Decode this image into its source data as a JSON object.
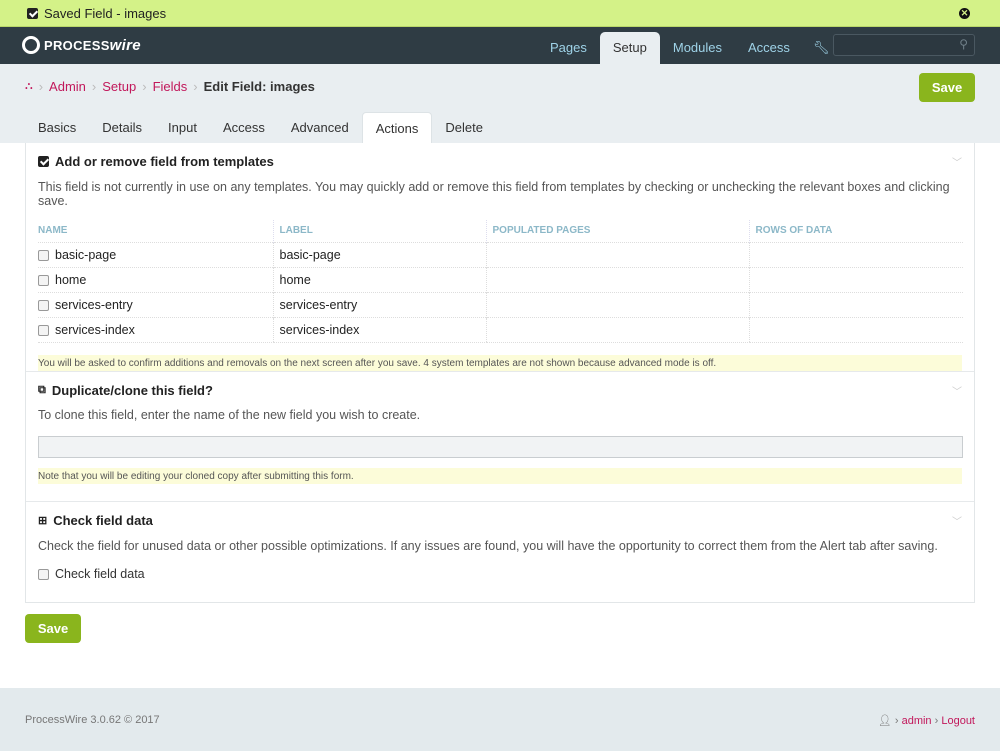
{
  "notice": {
    "text": "Saved Field - images",
    "icon": "check-square-icon",
    "close_icon": "close-circle-icon"
  },
  "header": {
    "logo": "PROCESSwire",
    "logo_a": "PROCESS",
    "logo_b": "wire",
    "nav": [
      "Pages",
      "Setup",
      "Modules",
      "Access"
    ],
    "active_nav": "Setup",
    "search_placeholder": ""
  },
  "breadcrumb": {
    "items": [
      "Admin",
      "Setup",
      "Fields"
    ],
    "current": "Edit Field: images"
  },
  "save_label": "Save",
  "tabs": [
    "Basics",
    "Details",
    "Input",
    "Access",
    "Advanced",
    "Actions",
    "Delete"
  ],
  "active_tab": "Actions",
  "sections": {
    "templates": {
      "title": "Add or remove field from templates",
      "desc": "This field is not currently in use on any templates. You may quickly add or remove this field from templates by checking or unchecking the relevant boxes and clicking save.",
      "columns": [
        "NAME",
        "LABEL",
        "POPULATED PAGES",
        "ROWS OF DATA"
      ],
      "rows": [
        {
          "name": "basic-page",
          "label": "basic-page"
        },
        {
          "name": "home",
          "label": "home"
        },
        {
          "name": "services-entry",
          "label": "services-entry"
        },
        {
          "name": "services-index",
          "label": "services-index"
        }
      ],
      "note": "You will be asked to confirm additions and removals on the next screen after you save. 4 system templates are not shown because advanced mode is off."
    },
    "clone": {
      "title": "Duplicate/clone this field?",
      "desc": "To clone this field, enter the name of the new field you wish to create.",
      "value": "",
      "note": "Note that you will be editing your cloned copy after submitting this form."
    },
    "check": {
      "title": "Check field data",
      "desc": "Check the field for unused data or other possible optimizations. If any issues are found, you will have the opportunity to correct them from the Alert tab after saving.",
      "checkbox_label": "Check field data"
    }
  },
  "footer": {
    "version": "ProcessWire 3.0.62 © 2017",
    "user": "admin",
    "logout": "Logout"
  },
  "colors": {
    "accent": "#8ab51d",
    "link": "#c2185b",
    "header": "#2f3c44",
    "notice": "#d4f288"
  }
}
